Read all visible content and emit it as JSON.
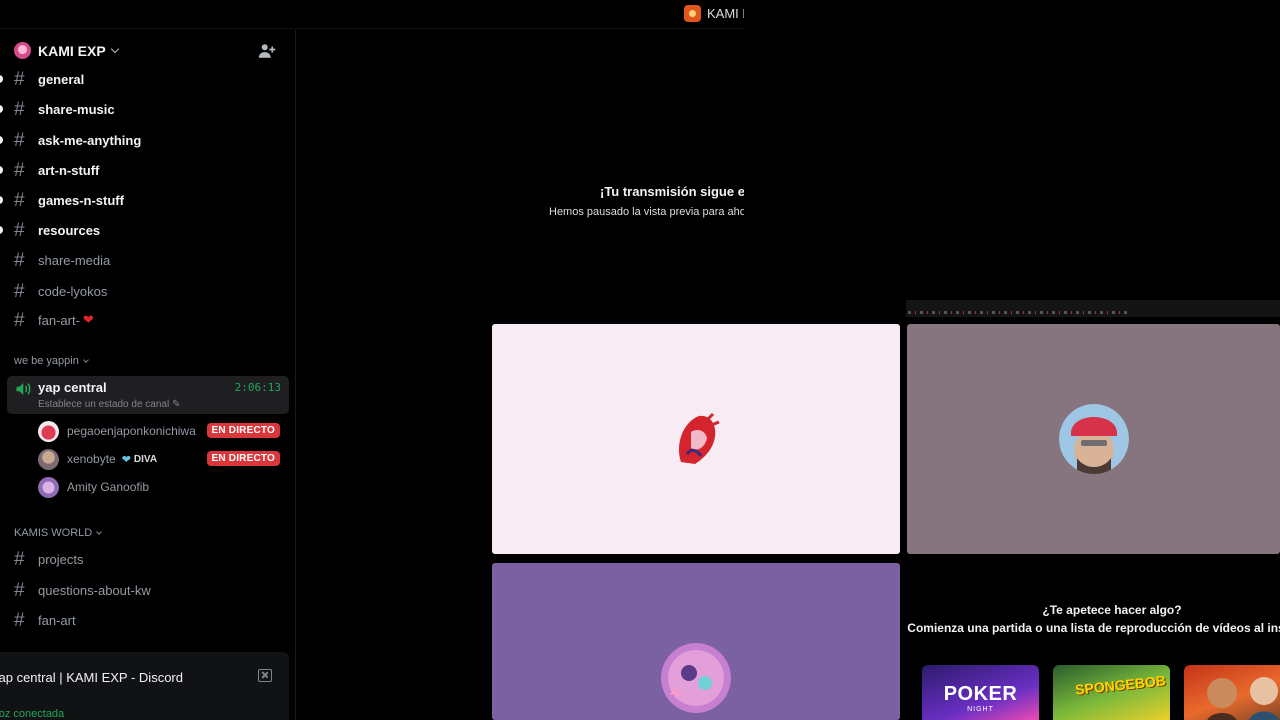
{
  "top_bar": {
    "server_label": "KAMI EXP"
  },
  "server": {
    "name": "KAMI EXP"
  },
  "channels": [
    {
      "name": "general"
    },
    {
      "name": "share-music"
    },
    {
      "name": "ask-me-anything"
    },
    {
      "name": "art-n-stuff"
    },
    {
      "name": "games-n-stuff"
    },
    {
      "name": "resources"
    },
    {
      "name": "share-media"
    },
    {
      "name": "code-lyokos"
    },
    {
      "name": "fan-art-"
    }
  ],
  "voice_category": {
    "name": "we be yappin"
  },
  "voice_channel": {
    "name": "yap central",
    "elapsed": "2:06:13",
    "status_prompt": "Establece un estado de canal"
  },
  "voice_users": [
    {
      "name": "pegaoenjaponkonichiwa",
      "badge": "EN DIRECTO"
    },
    {
      "name": "xenobyte",
      "tag": "DIVA",
      "badge": "EN DIRECTO"
    },
    {
      "name": "Amity Ganoofib"
    }
  ],
  "world_category": {
    "name": "KAMIS WORLD"
  },
  "world_channels": [
    {
      "name": "projects"
    },
    {
      "name": "questions-about-kw"
    },
    {
      "name": "fan-art"
    }
  ],
  "voice_popup": {
    "title": "yap central | KAMI EXP - Discord",
    "status": "Voz conectada"
  },
  "stream": {
    "paused_title": "¡Tu transmisión sigue en directo!",
    "paused_subtitle": "Hemos pausado la vista previa para ahorrar recursos."
  },
  "activity": {
    "title": "¿Te apetece hacer algo?",
    "subtitle": "Comienza una partida o una lista de reproducción de vídeos al instante.",
    "games": [
      {
        "name": "POKER",
        "sub": "NIGHT"
      },
      {
        "name": "SPONGEBOB"
      },
      {
        "name": ""
      }
    ]
  },
  "colors": {
    "live_badge": "#da373c",
    "voice_green": "#23a55a",
    "tile_pink": "#f7ebf4",
    "tile_mauve": "#86747f",
    "tile_purple": "#7c61a2"
  }
}
